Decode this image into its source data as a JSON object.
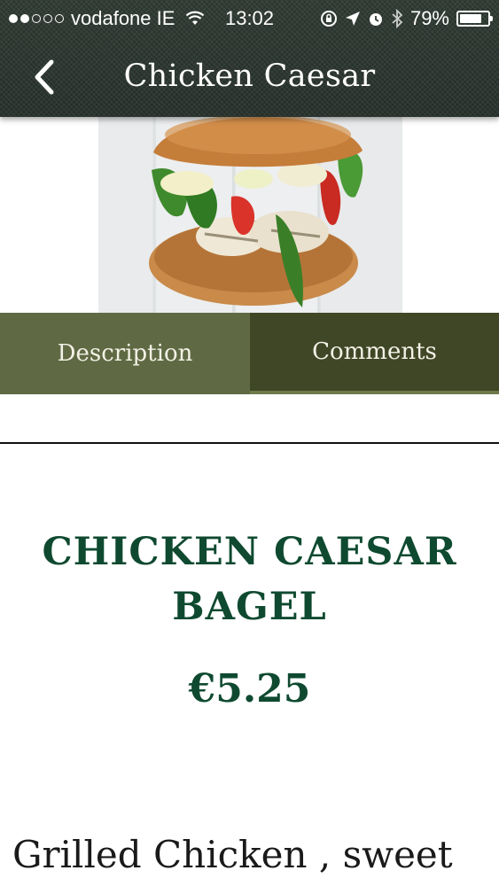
{
  "status_bar": {
    "carrier": "vodafone IE",
    "time": "13:02",
    "battery": "79%",
    "signal_bars_filled": 2,
    "signal_bars_total": 5,
    "battery_level": 0.79
  },
  "nav": {
    "title": "Chicken Caesar",
    "back_icon": "chevron-left-icon"
  },
  "tabs": [
    {
      "label": "Description",
      "selected": true
    },
    {
      "label": "Comments",
      "selected": false
    }
  ],
  "product": {
    "name_line1": "CHICKEN CAESAR",
    "name_line2": "BAGEL",
    "price": "€5.25",
    "description": "Grilled Chicken , sweet"
  },
  "colors": {
    "header_bg": "#2f3a33",
    "tab_selected": "#5f6a44",
    "tab_unselected": "#3f4726",
    "title_green": "#0f4a30"
  }
}
